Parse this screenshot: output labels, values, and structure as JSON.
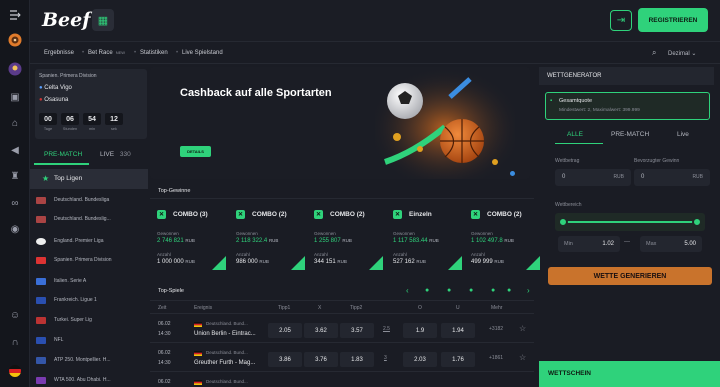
{
  "app": {
    "logo": "Beef"
  },
  "header": {
    "register_label": "REGISTRIEREN"
  },
  "subnav": {
    "items": [
      "Ergebnisse",
      "Bet Race",
      "Statistiken",
      "Live Spielstand"
    ],
    "new_badge": "NEW",
    "odds_format": "Dezimal"
  },
  "live_match": {
    "league": "Spanien. Primera Division",
    "team1": "Celta Vigo",
    "team2": "Osasuna",
    "countdown": [
      {
        "value": "00",
        "label": "Tage"
      },
      {
        "value": "06",
        "label": "Stunden"
      },
      {
        "value": "54",
        "label": "min"
      },
      {
        "value": "12",
        "label": "sek"
      }
    ]
  },
  "left_panel": {
    "tab_prematch": "PRE-MATCH",
    "tab_live": "LIVE",
    "live_count": "330",
    "top_leagues": "Top Ligen",
    "leagues": [
      "Deutschland. Bundesliga",
      "Deutschland. Bundeslig...",
      "England. Premier Liga",
      "Spanien. Primera Division",
      "Italien. Serie A",
      "Frankreich. Ligue 1",
      "Turkei. Super Lig",
      "NFL",
      "ATP 250. Montpellier. H...",
      "WTA 500. Abu Dhabi. H..."
    ]
  },
  "banner": {
    "title": "Cashback auf alle Sportarten",
    "button": "DETAILS"
  },
  "top_gewinne": {
    "title": "Top-Gewinne",
    "won_label": "Gewonnen",
    "stake_label": "Anzahl",
    "cards": [
      {
        "name": "COMBO",
        "count": "(3)",
        "won": "2 746 821",
        "stake": "1 000 000",
        "currency": "RUB"
      },
      {
        "name": "COMBO",
        "count": "(2)",
        "won": "2 118 322.4",
        "stake": "986 000",
        "currency": "RUB"
      },
      {
        "name": "COMBO",
        "count": "(2)",
        "won": "1 255 807",
        "stake": "344 151",
        "currency": "RUB"
      },
      {
        "name": "Einzeln",
        "count": "",
        "won": "1 117 583.44",
        "stake": "527 162",
        "currency": "RUB"
      },
      {
        "name": "COMBO",
        "count": "(2)",
        "won": "1 102 497.8",
        "stake": "499 999",
        "currency": "RUB"
      }
    ]
  },
  "top_spiele": {
    "title": "Top-Spiele",
    "columns": [
      "Zeit",
      "Ereignis",
      "Tipp1",
      "X",
      "Tipp2",
      "O",
      "U",
      "Mehr"
    ],
    "rows": [
      {
        "date": "06.02",
        "time": "14:30",
        "league": "Deutschland. Bund...",
        "match": "Union Berlin  -  Eintrac...",
        "o1": "2.05",
        "ox": "3.62",
        "o2": "3.57",
        "total": "2.5",
        "over": "1.9",
        "under": "1.94",
        "more": "+3182"
      },
      {
        "date": "06.02",
        "time": "14:30",
        "league": "Deutschland. Bund...",
        "match": "Greuther Furth  -  Mag...",
        "o1": "3.86",
        "ox": "3.76",
        "o2": "1.83",
        "total": "3",
        "over": "2.03",
        "under": "1.76",
        "more": "+1861"
      },
      {
        "date": "06.02",
        "time": "",
        "league": "Deutschland. Bund...",
        "match": "",
        "o1": "",
        "ox": "",
        "o2": "",
        "total": "",
        "over": "",
        "under": "",
        "more": ""
      }
    ]
  },
  "wettgenerator": {
    "title": "WETTGENERATOR",
    "gesamtquote_label": "Gesamtquote",
    "gesamtquote_sub": "Mindestwert: 2, Maximalwert: 399.999",
    "tabs": [
      "ALLE",
      "PRE-MATCH",
      "Live"
    ],
    "wettbetrag_label": "Wettbetrag",
    "gewinn_label": "Bevorzugter Gewinn",
    "wettbetrag_value": "0",
    "gewinn_value": "0",
    "currency": "RUB",
    "range_label": "Wettbereich",
    "min_label": "Min",
    "min_value": "1.02",
    "max_label": "Max",
    "max_value": "5.00",
    "generate_label": "WETTE GENERIEREN"
  },
  "wettschein": {
    "label": "WETTSCHEIN"
  },
  "colors": {
    "accent": "#2fd27b",
    "generate": "#c9732c",
    "bg": "#1a1c24"
  }
}
